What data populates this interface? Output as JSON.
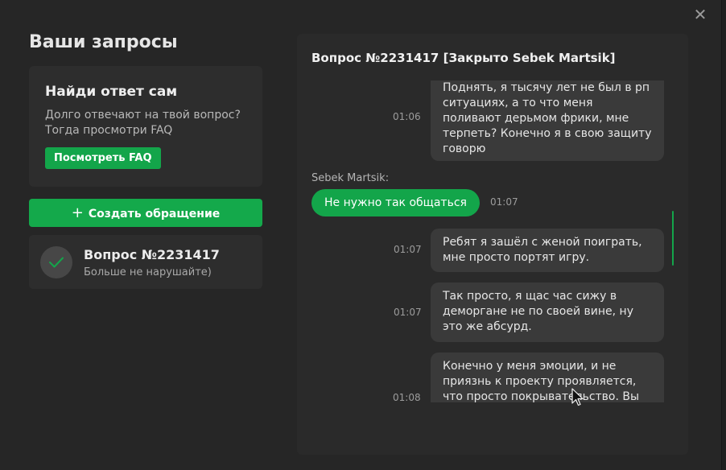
{
  "page_title": "Ваши запросы",
  "faq": {
    "title": "Найди ответ сам",
    "text": "Долго отвечают на твой вопрос? Тогда просмотри FAQ",
    "button": "Посмотреть FAQ"
  },
  "create_button": "Создать обращение",
  "ticket": {
    "title": "Вопрос №2231417",
    "subtitle": "Больше не нарушайте)"
  },
  "chat": {
    "title": "Вопрос №2231417 [Закрыто Sebek Martsik]",
    "messages": [
      {
        "side": "right",
        "time": "01:06",
        "text": "Поднять, я тысячу лет не был в рп ситуациях, а то что меня поливают дерьмом фрики, мне терпеть? Конечно я в свою защиту говорю"
      },
      {
        "side": "left",
        "sender": "Sebek Martsik:",
        "time": "01:07",
        "text": "Не нужно так общаться"
      },
      {
        "side": "right",
        "time": "01:07",
        "text": "Ребят я зашёл с женой поиграть, мне просто портят игру."
      },
      {
        "side": "right",
        "time": "01:07",
        "text": "Так просто, я щас час сижу в деморгане не по своей вине, ну это же абсурд."
      },
      {
        "side": "right",
        "time": "01:08",
        "text": "Конечно у меня эмоции, и не приязнь к проекту проявляется, что просто покрывательство. Вы"
      }
    ]
  },
  "colors": {
    "accent": "#13a54a",
    "background": "#262626",
    "card": "#2d2d2d",
    "bubble": "#3a3a3a"
  },
  "icons": {
    "close": "close-icon",
    "check": "check-icon",
    "plus": "plus-icon",
    "cursor": "mouse-cursor-icon"
  }
}
